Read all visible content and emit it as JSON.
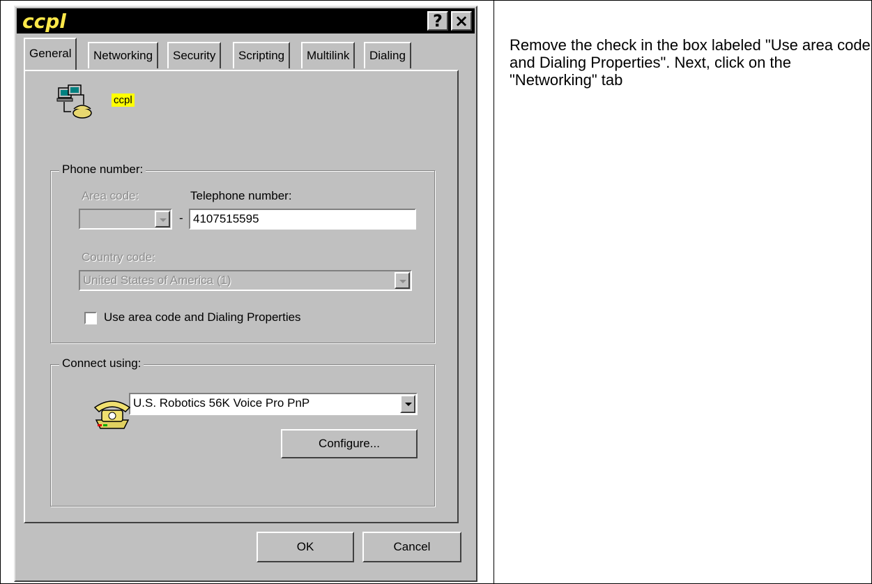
{
  "dialog": {
    "title": "ccpl",
    "help_glyph": "?",
    "close_glyph": "×",
    "tabs": [
      "General",
      "Networking",
      "Security",
      "Scripting",
      "Multilink",
      "Dialing"
    ],
    "active_tab": "General",
    "connection_name": "ccpl",
    "phone_group": {
      "label": "Phone number:",
      "area_code_label": "Area code:",
      "area_code_value": "",
      "separator": "-",
      "telephone_label": "Telephone number:",
      "telephone_value": "4107515595",
      "country_code_label": "Country code:",
      "country_code_value": "United States of America (1)",
      "use_area_code_label": "Use area code and Dialing Properties",
      "use_area_code_checked": false
    },
    "connect_group": {
      "label": "Connect using:",
      "modem_value": "U.S. Robotics 56K Voice Pro PnP",
      "configure_label": "Configure..."
    },
    "ok_label": "OK",
    "cancel_label": "Cancel"
  },
  "instructions": {
    "text": "Remove the check in the box labeled \"Use area code and Dialing Properties\". Next, click on the \"Networking\" tab"
  },
  "colors": {
    "titlebar_bg": "#000000",
    "title_text": "#ffe84a",
    "dialog_face": "#c0c0c0",
    "highlight": "#ffff00"
  }
}
